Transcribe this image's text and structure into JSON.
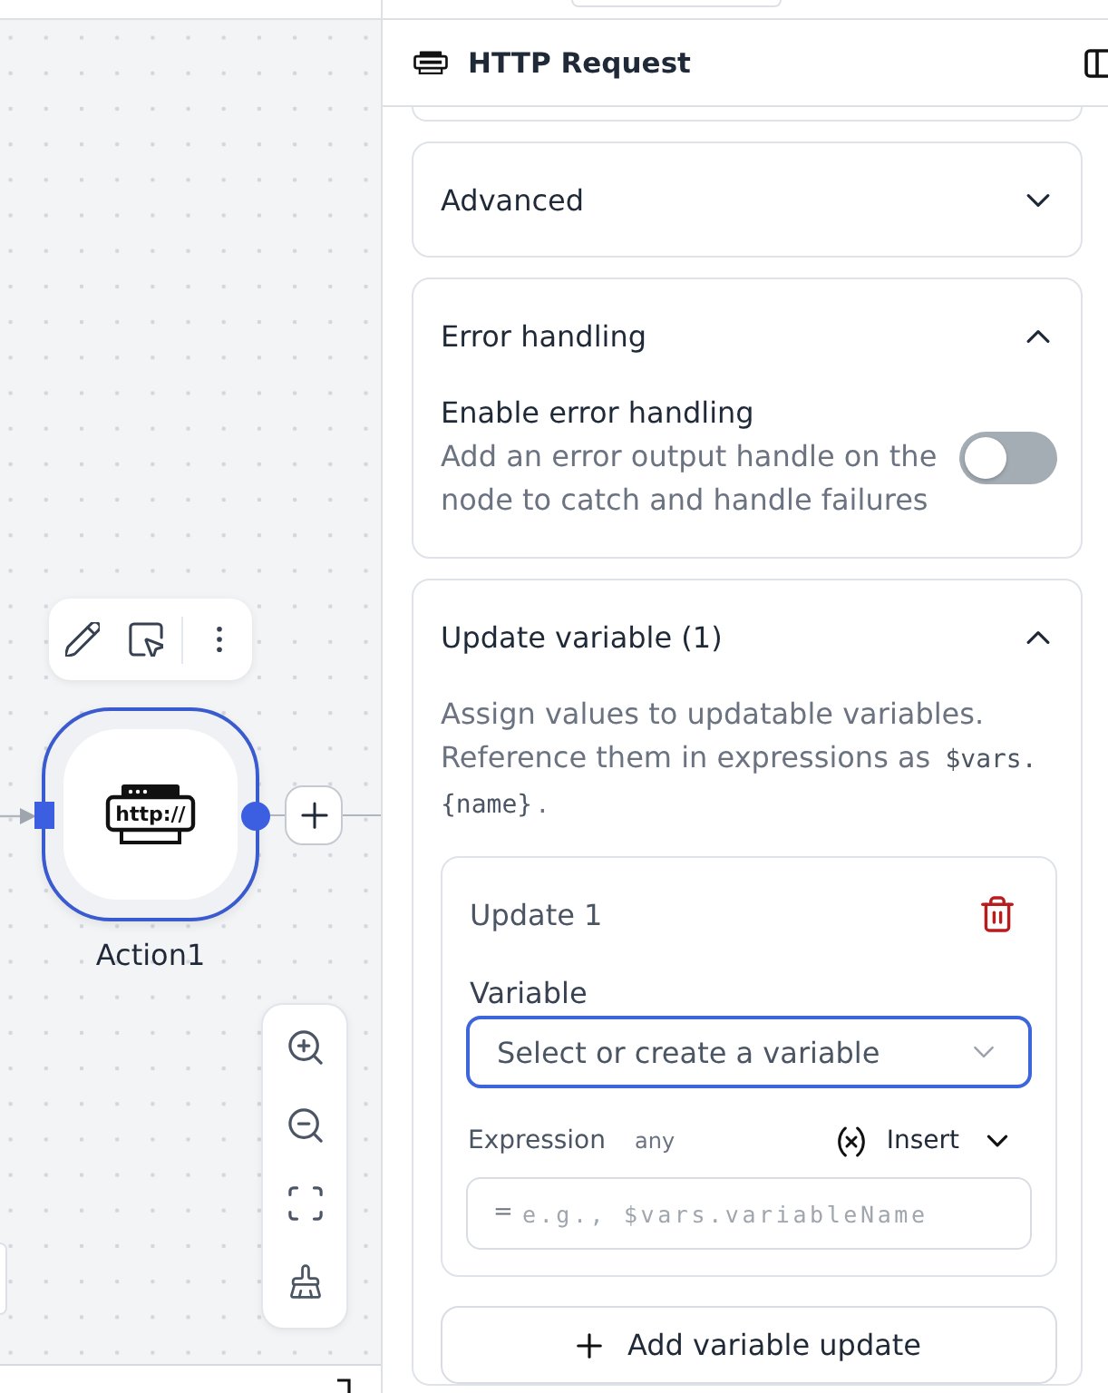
{
  "canvas": {
    "node": {
      "label": "Action1",
      "icon_text": "http://",
      "selected": true
    }
  },
  "panel": {
    "title": "HTTP Request",
    "sections": [
      {
        "kind": "plain",
        "title": "Advanced",
        "expanded": false
      },
      {
        "kind": "toggle",
        "title": "Error handling",
        "expanded": true,
        "setting": {
          "label": "Enable error handling",
          "description": "Add an error output handle on the node to catch and handle failures",
          "on": false
        }
      },
      {
        "kind": "updates",
        "title": "Update variable (1)",
        "expanded": true,
        "description": {
          "text": "Assign values to updatable variables. Reference them in expressions as",
          "code": "$vars.{name}",
          "end": "."
        },
        "updates": [
          {
            "title": "Update 1",
            "variable": {
              "label": "Variable",
              "placeholder": "Select or create a variable",
              "focused": true
            },
            "expression": {
              "label": "Expression",
              "type": "any",
              "insert": "Insert",
              "prefix": "=",
              "placeholder": "e.g., $vars.variableName"
            }
          }
        ],
        "add_button": "Add variable update"
      }
    ]
  }
}
